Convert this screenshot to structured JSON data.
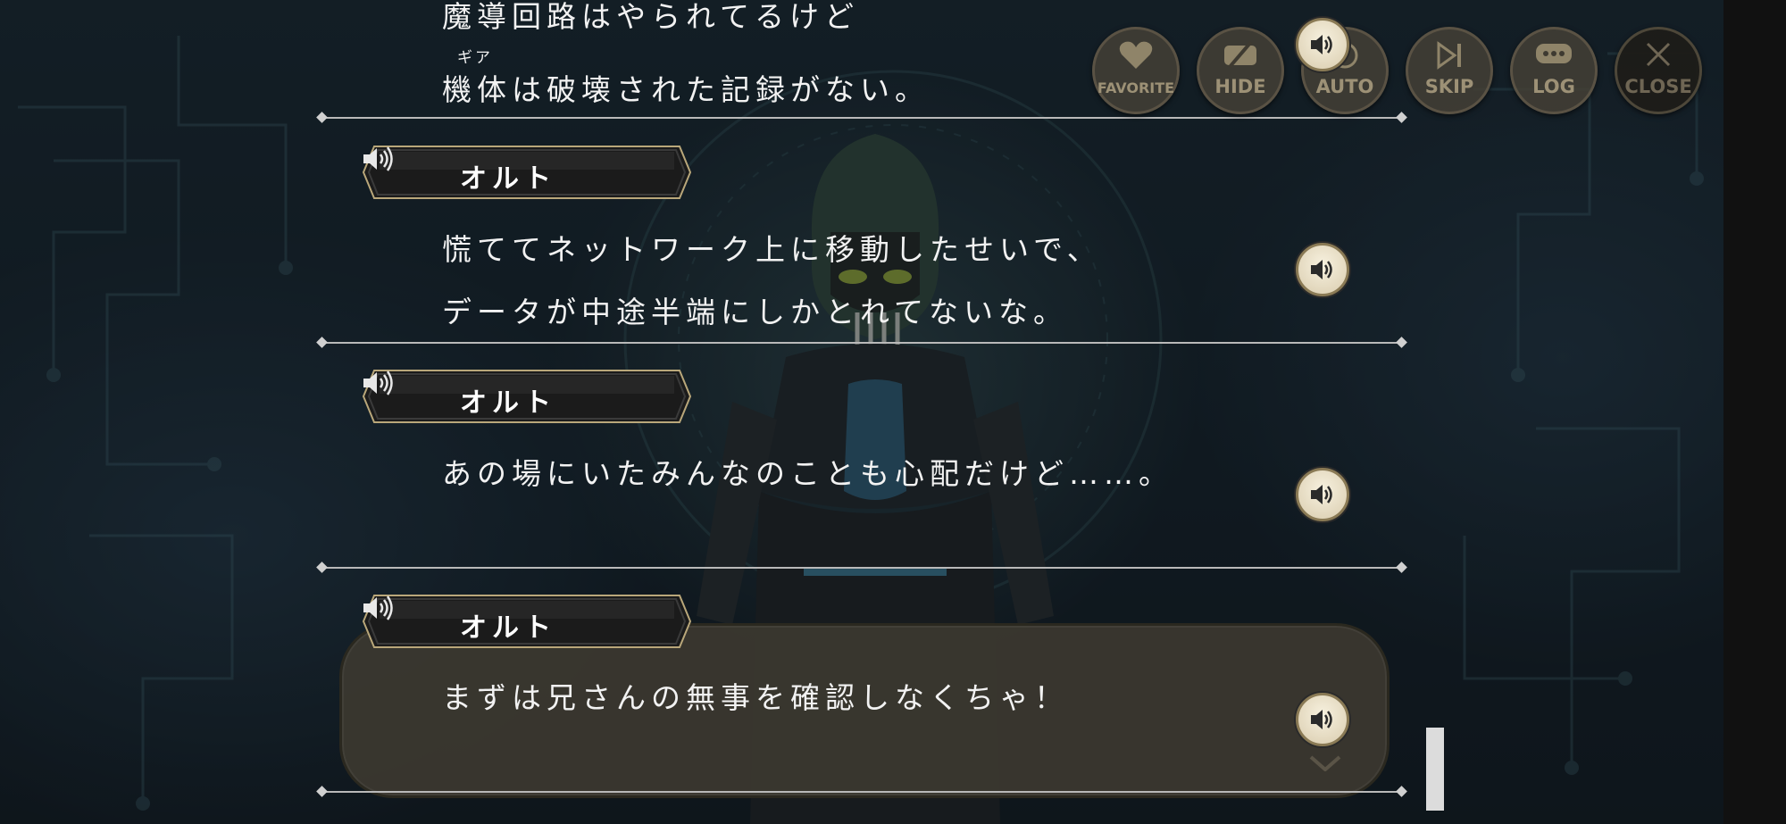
{
  "header_buttons": [
    {
      "id": "favorite",
      "label": "FAVORITE",
      "icon": "heart-icon"
    },
    {
      "id": "hide",
      "label": "HIDE",
      "icon": "hide-icon"
    },
    {
      "id": "auto",
      "label": "AUTO",
      "icon": "auto-icon"
    },
    {
      "id": "skip",
      "label": "SKIP",
      "icon": "skip-icon"
    },
    {
      "id": "log",
      "label": "LOG",
      "icon": "chat-bubble-icon"
    },
    {
      "id": "close",
      "label": "CLOSE",
      "icon": "close-icon"
    }
  ],
  "log": {
    "partial_entry": {
      "lines": [
        "魔導回路はやられてるけど",
        "機体は破壊された記録がない。"
      ],
      "ruby": "ギア"
    },
    "entries": [
      {
        "speaker": "オルト",
        "lines": [
          "慌ててネットワーク上に移動したせいで、",
          "データが中途半端にしかとれてないな。"
        ]
      },
      {
        "speaker": "オルト",
        "lines": [
          "あの場にいたみんなのことも心配だけど……。"
        ]
      },
      {
        "speaker": "オルト",
        "lines": [
          "まずは兄さんの無事を確認しなくちゃ！"
        ]
      }
    ]
  },
  "colors": {
    "accent": "#c8b48a",
    "panel": "#3c3830",
    "separator": "#b9b9b9"
  }
}
